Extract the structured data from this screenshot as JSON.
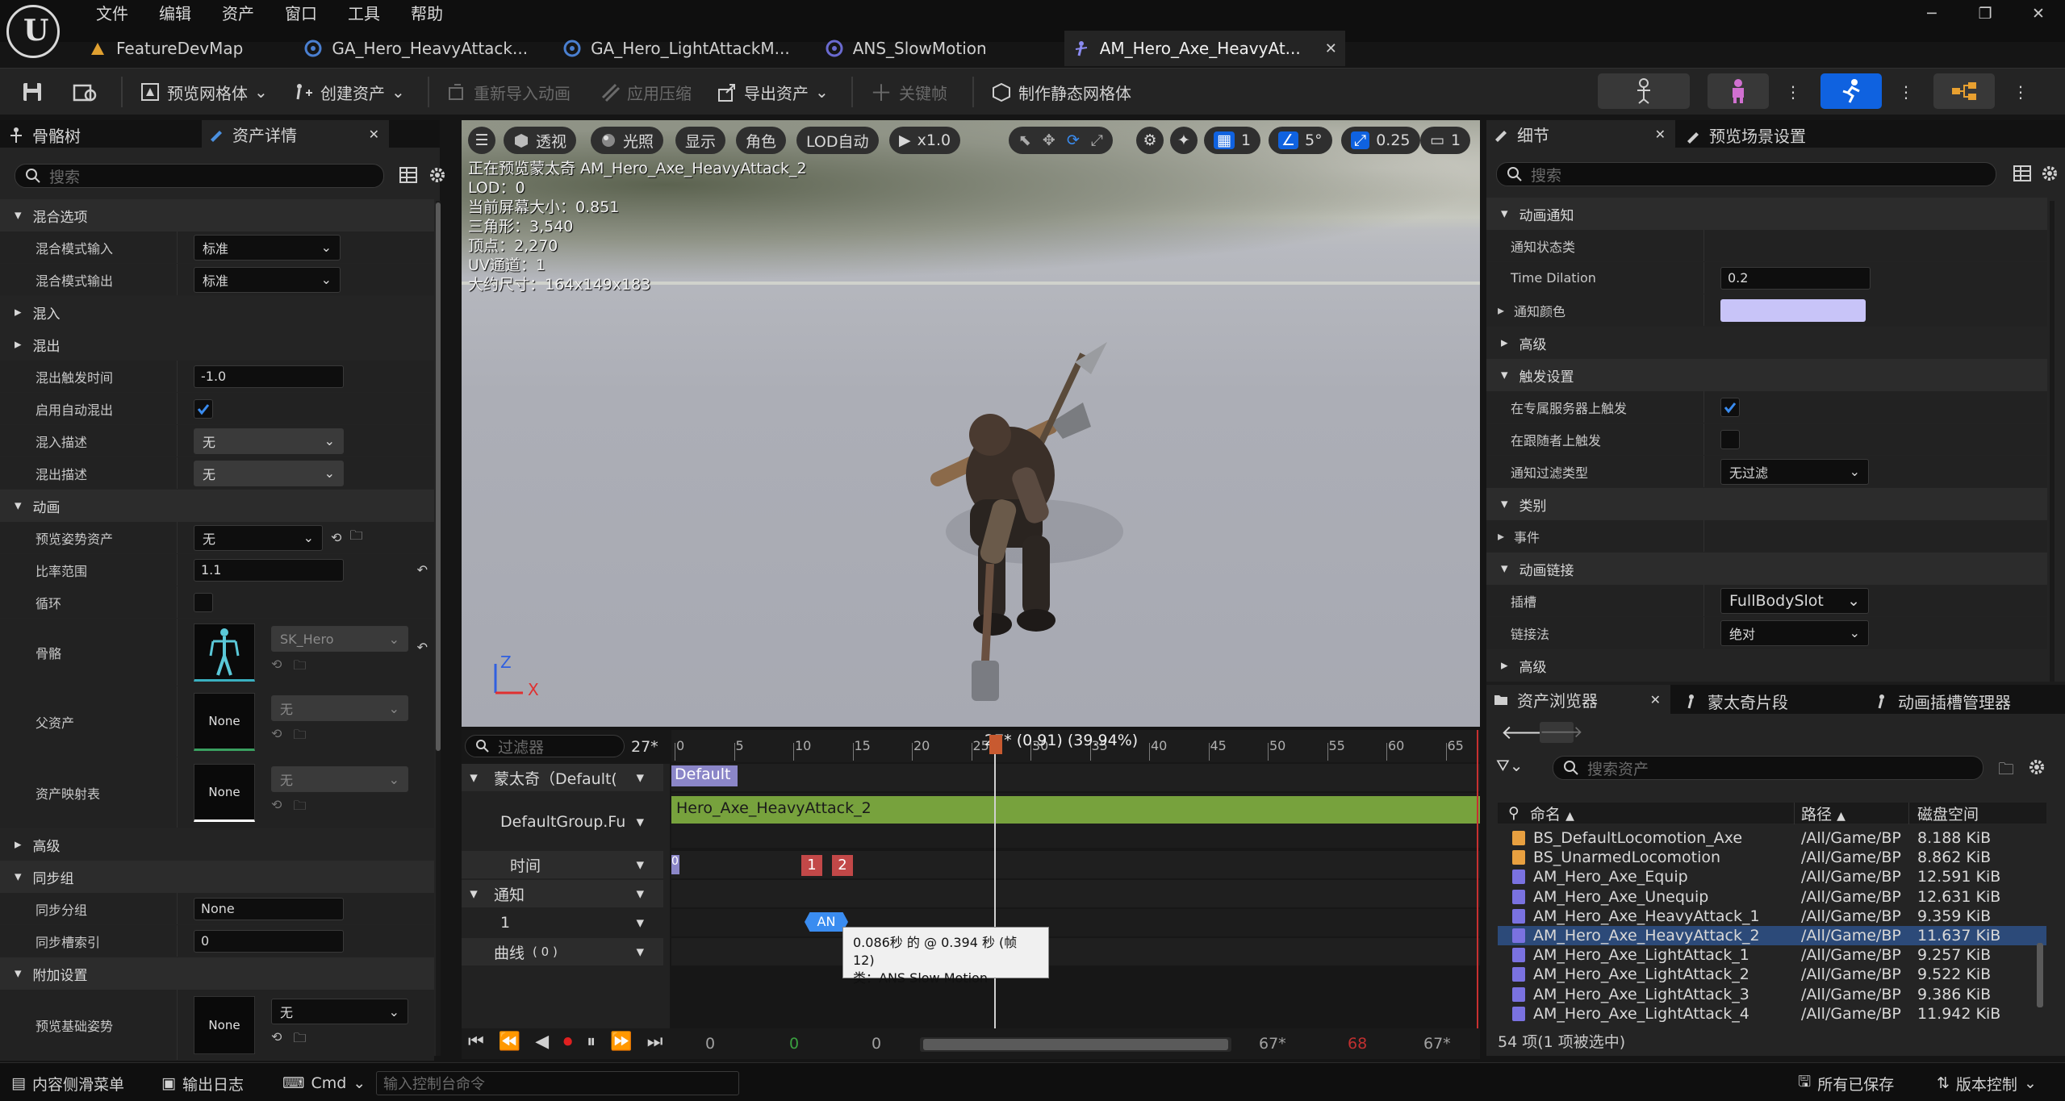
{
  "menubar": [
    "文件",
    "编辑",
    "资产",
    "窗口",
    "工具",
    "帮助"
  ],
  "tabs": [
    {
      "label": "FeatureDevMap",
      "icon": "level-icon"
    },
    {
      "label": "GA_Hero_HeavyAttack...",
      "icon": "blueprint-icon"
    },
    {
      "label": "GA_Hero_LightAttackM...",
      "icon": "blueprint-icon"
    },
    {
      "label": "ANS_SlowMotion",
      "icon": "blueprint-icon"
    },
    {
      "label": "AM_Hero_Axe_HeavyAt...",
      "icon": "montage-icon",
      "active": true
    }
  ],
  "toolbar": {
    "preview_mesh": "预览网格体",
    "create_asset": "创建资产",
    "reimport": "重新导入动画",
    "apply_compression": "应用压缩",
    "export_asset": "导出资产",
    "keyframe": "关键帧",
    "make_static_mesh": "制作静态网格体"
  },
  "left_panel": {
    "tab_skeleton": "骨骼树",
    "tab_asset_details": "资产详情",
    "search_placeholder": "搜索",
    "sections": {
      "blend_options": "混合选项",
      "blend_in": "混入",
      "blend_out": "混出",
      "animation": "动画",
      "advanced": "高级",
      "sync_group": "同步组",
      "additive": "附加设置"
    },
    "props": {
      "blend_mode_in": {
        "label": "混合模式输入",
        "value": "标准"
      },
      "blend_mode_out": {
        "label": "混合模式输出",
        "value": "标准"
      },
      "blend_out_trigger": {
        "label": "混出触发时间",
        "value": "-1.0"
      },
      "auto_blend_out": {
        "label": "启用自动混出"
      },
      "blend_in_desc": {
        "label": "混入描述",
        "value": "无"
      },
      "blend_out_desc": {
        "label": "混出描述",
        "value": "无"
      },
      "preview_pose": {
        "label": "预览姿势资产",
        "value": "无"
      },
      "rate_scale": {
        "label": "比率范围",
        "value": "1.1"
      },
      "loop": {
        "label": "循环"
      },
      "skeleton": {
        "label": "骨骼",
        "value": "SK_Hero"
      },
      "parent_asset": {
        "label": "父资产",
        "thumb": "None",
        "value": "无"
      },
      "asset_mapping": {
        "label": "资产映射表",
        "thumb": "None",
        "value": "无"
      },
      "sync_group": {
        "label": "同步分组",
        "value": "None"
      },
      "sync_slot": {
        "label": "同步槽索引",
        "value": "0"
      },
      "preview_base_pose": {
        "label": "预览基础姿势",
        "thumb": "None",
        "value": "无"
      }
    }
  },
  "viewport": {
    "perspective": "透视",
    "lit": "光照",
    "show": "显示",
    "character": "角色",
    "lod": "LOD自动",
    "speed": "x1.0",
    "grid_size": "1",
    "rot_snap": "5°",
    "scale_snap": "0.25",
    "camera_speed": "1",
    "info": [
      "正在预览蒙太奇 AM_Hero_Axe_HeavyAttack_2",
      "LOD：0",
      "当前屏幕大小：0.851",
      "三角形：3,540",
      "顶点：2,270",
      "UV通道：1",
      "大约尺寸：164x149x183"
    ],
    "axis_z": "Z",
    "axis_x": "X"
  },
  "timeline": {
    "filter_placeholder": "过滤器",
    "frame_display": "27*",
    "playhead_label": "27* (0.91) (39.94%)",
    "ruler_ticks": [
      "0",
      "5",
      "10",
      "15",
      "20",
      "25",
      "30",
      "35",
      "40",
      "45",
      "50",
      "55",
      "60",
      "65"
    ],
    "tracks": {
      "montage": "蒙太奇（Default(",
      "slot": "DefaultGroup.Fu",
      "time": "时间",
      "notify": "通知",
      "notify_track": "1",
      "curves": "曲线",
      "curves_count": "( 0 )"
    },
    "section_label": "Default",
    "segment_label": "Hero_Axe_HeavyAttack_2",
    "time_markers": [
      "1",
      "2"
    ],
    "left_marker": "0",
    "notify_label": "AN",
    "tooltip_line1": "0.086秒 的 @ 0.394 秒 (帧 12)",
    "tooltip_line2": "类：ANS Slow Motion",
    "transport": {
      "start": "0",
      "in": "0",
      "current": "0",
      "end1": "67*",
      "out": "68",
      "end2": "67*"
    }
  },
  "right_panel": {
    "tab_details": "细节",
    "tab_preview_scene": "预览场景设置",
    "search_placeholder": "搜索",
    "sections": {
      "anim_notify": "动画通知",
      "advanced1": "高级",
      "trigger_settings": "触发设置",
      "category": "类别",
      "event": "事件",
      "anim_link": "动画链接",
      "advanced2": "高级"
    },
    "props": {
      "notify_state_class": {
        "label": "通知状态类"
      },
      "time_dilation": {
        "label": "Time Dilation",
        "value": "0.2"
      },
      "notify_color": {
        "label": "通知颜色",
        "color": "#c8c4f8"
      },
      "trigger_dedicated": {
        "label": "在专属服务器上触发"
      },
      "trigger_follower": {
        "label": "在跟随者上触发"
      },
      "filter_type": {
        "label": "通知过滤类型",
        "value": "无过滤"
      },
      "slot": {
        "label": "插槽",
        "value": "FullBodySlot"
      },
      "link_method": {
        "label": "链接法",
        "value": "绝对"
      }
    }
  },
  "asset_browser": {
    "tab_browser": "资产浏览器",
    "tab_montage_sections": "蒙太奇片段",
    "tab_slot_manager": "动画插槽管理器",
    "search_placeholder": "搜索资产",
    "col_name": "命名",
    "col_path": "路径",
    "col_size": "磁盘空间",
    "rows": [
      {
        "name": "BS_DefaultLocomotion_Axe",
        "path": "/All/Game/BP",
        "size": "8.188 KiB",
        "type": "blendspace"
      },
      {
        "name": "BS_UnarmedLocomotion",
        "path": "/All/Game/BP",
        "size": "8.862 KiB",
        "type": "blendspace"
      },
      {
        "name": "AM_Hero_Axe_Equip",
        "path": "/All/Game/BP",
        "size": "12.591 KiB",
        "type": "montage"
      },
      {
        "name": "AM_Hero_Axe_Unequip",
        "path": "/All/Game/BP",
        "size": "12.631 KiB",
        "type": "montage"
      },
      {
        "name": "AM_Hero_Axe_HeavyAttack_1",
        "path": "/All/Game/BP",
        "size": "9.359 KiB",
        "type": "montage"
      },
      {
        "name": "AM_Hero_Axe_HeavyAttack_2",
        "path": "/All/Game/BP",
        "size": "11.637 KiB",
        "type": "montage",
        "selected": true
      },
      {
        "name": "AM_Hero_Axe_LightAttack_1",
        "path": "/All/Game/BP",
        "size": "9.257 KiB",
        "type": "montage"
      },
      {
        "name": "AM_Hero_Axe_LightAttack_2",
        "path": "/All/Game/BP",
        "size": "9.522 KiB",
        "type": "montage"
      },
      {
        "name": "AM_Hero_Axe_LightAttack_3",
        "path": "/All/Game/BP",
        "size": "9.386 KiB",
        "type": "montage"
      },
      {
        "name": "AM_Hero_Axe_LightAttack_4",
        "path": "/All/Game/BP",
        "size": "11.942 KiB",
        "type": "montage"
      }
    ],
    "count": "54 项(1 项被选中)"
  },
  "statusbar": {
    "content_drawer": "内容侧滑菜单",
    "output_log": "输出日志",
    "cmd": "Cmd",
    "console_placeholder": "输入控制台命令",
    "all_saved": "所有已保存",
    "source_control": "版本控制"
  },
  "colors": {
    "accent_blue": "#0f62e0",
    "segment_green": "#77a23d",
    "section_purple": "#8b86c8",
    "marker_red": "#c24848",
    "notify_color": "#c8c4f8",
    "selection": "#2c4a79"
  }
}
